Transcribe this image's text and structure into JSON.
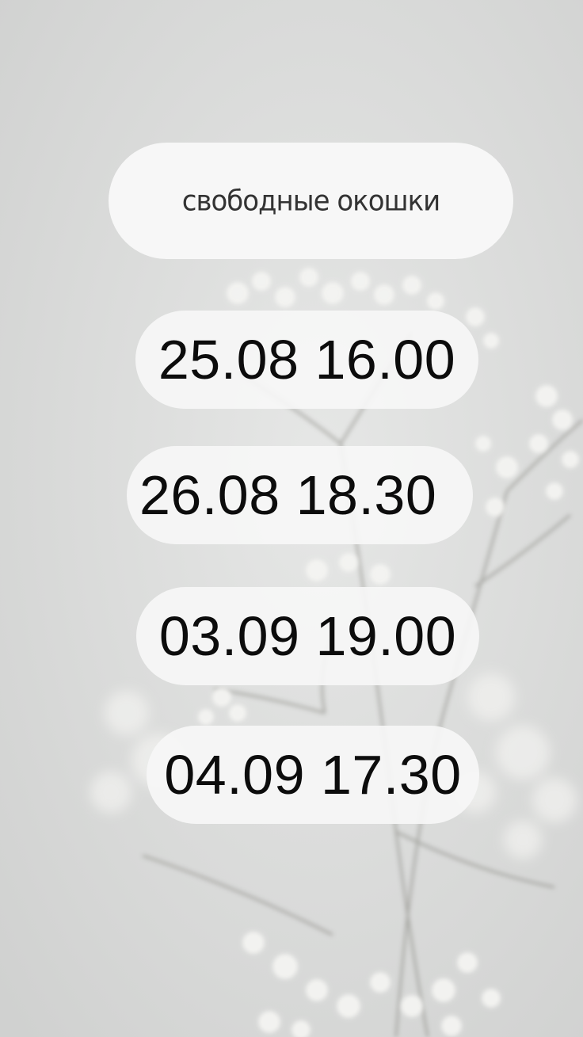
{
  "title": "свободные окошки",
  "slots": [
    {
      "label": "25.08 16.00"
    },
    {
      "label": "26.08 18.30"
    },
    {
      "label": "03.09 19.00"
    },
    {
      "label": "04.09 17.30"
    }
  ],
  "colors": {
    "background": "#dcdddc",
    "pill": "#f7f7f7",
    "text": "#0c0c0c",
    "title_text": "#333333"
  }
}
